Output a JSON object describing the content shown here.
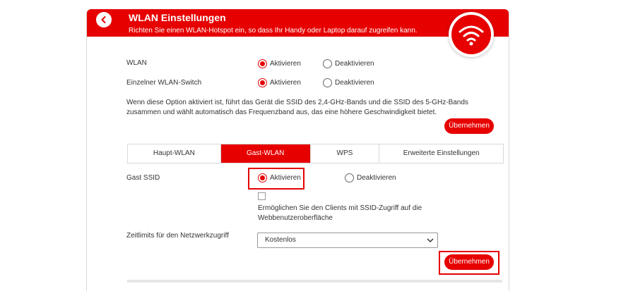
{
  "header": {
    "title": "WLAN Einstellungen",
    "subtitle": "Richten Sie einen WLAN-Hotspot ein, so dass Ihr Handy oder Laptop darauf zugreifen kann."
  },
  "wlan": {
    "label": "WLAN",
    "options": [
      "Aktivieren",
      "Deaktivieren"
    ],
    "selected": "Aktivieren"
  },
  "switch": {
    "label": "Einzelner WLAN-Switch",
    "options": [
      "Aktivieren",
      "Deaktivieren"
    ],
    "selected": "Aktivieren",
    "description": "Wenn diese Option aktiviert ist, führt das Gerät die SSID des 2,4-GHz-Bands und die SSID des 5-GHz-Bands zusammen und wählt automatisch das Frequenzband aus, das eine höhere Geschwindigkeit bietet."
  },
  "apply_label": "Übernehmen",
  "tabs": [
    "Haupt-WLAN",
    "Gast-WLAN",
    "WPS",
    "Erweiterte Einstellungen"
  ],
  "active_tab": "Gast-WLAN",
  "guest": {
    "label": "Gast SSID",
    "options": [
      "Aktivieren",
      "Deaktivieren"
    ],
    "selected": "Aktivieren",
    "checkbox_label": "Ermöglichen Sie den Clients mit SSID-Zugriff auf die Webbenutzeroberfläche",
    "checkbox_checked": false,
    "time_limit_label": "Zeitlimits für den Netzwerkzugriff",
    "time_limit_value": "Kostenlos"
  },
  "colors": {
    "accent": "#e60000"
  },
  "icons": {
    "back": "chevron-left-icon",
    "wifi": "wifi-icon",
    "dropdown": "chevron-down-icon"
  }
}
